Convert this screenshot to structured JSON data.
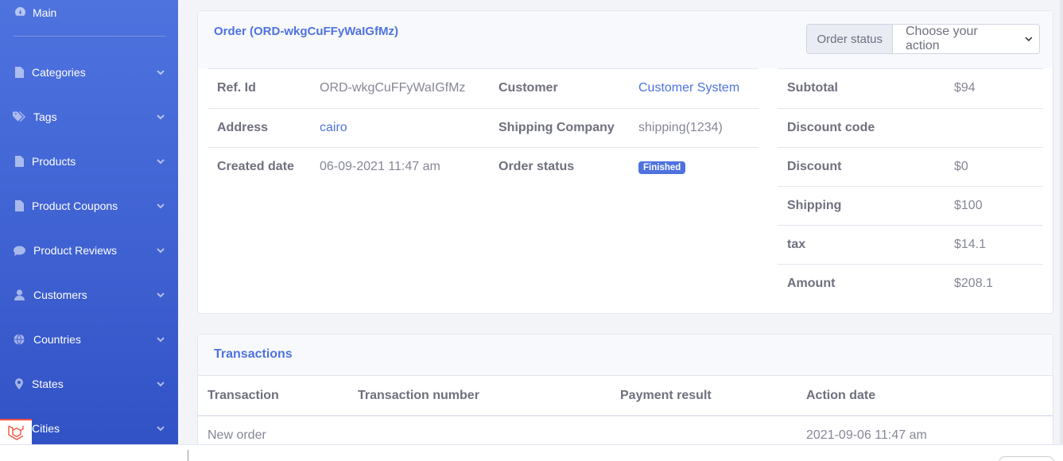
{
  "sidebar": {
    "main_label": "Main",
    "items": [
      {
        "label": "Categories",
        "icon": "file-icon"
      },
      {
        "label": "Tags",
        "icon": "tags-icon"
      },
      {
        "label": "Products",
        "icon": "file-icon"
      },
      {
        "label": "Product Coupons",
        "icon": "file-icon"
      },
      {
        "label": "Product Reviews",
        "icon": "comment-icon"
      },
      {
        "label": "Customers",
        "icon": "user-icon"
      },
      {
        "label": "Countries",
        "icon": "globe-icon"
      },
      {
        "label": "States",
        "icon": "map-marker-icon"
      },
      {
        "label": "Cities",
        "icon": "map-marker-icon"
      }
    ]
  },
  "order": {
    "title": "Order (ORD-wkgCuFFyWaIGfMz)",
    "status_label": "Order status",
    "status_select_value": "Choose your action",
    "details": {
      "ref_id_label": "Ref. Id",
      "ref_id": "ORD-wkgCuFFyWaIGfMz",
      "customer_label": "Customer",
      "customer": "Customer System",
      "address_label": "Address",
      "address": "cairo",
      "shipping_company_label": "Shipping Company",
      "shipping_company": "shipping(1234)",
      "created_label": "Created date",
      "created": "06-09-2021 11:47 am",
      "status_label": "Order status",
      "status": "Finished"
    },
    "totals": {
      "subtotal_label": "Subtotal",
      "subtotal": "$94",
      "discount_code_label": "Discount code",
      "discount_code": "",
      "discount_label": "Discount",
      "discount": "$0",
      "shipping_label": "Shipping",
      "shipping": "$100",
      "tax_label": "tax",
      "tax": "$14.1",
      "amount_label": "Amount",
      "amount": "$208.1"
    }
  },
  "transactions": {
    "title": "Transactions",
    "columns": [
      "Transaction",
      "Transaction number",
      "Payment result",
      "Action date"
    ],
    "rows": [
      [
        "New order",
        "",
        "",
        "2021-09-06 11:47 am"
      ]
    ]
  },
  "colors": {
    "primary": "#4e73df",
    "badge": "#4e73df"
  }
}
